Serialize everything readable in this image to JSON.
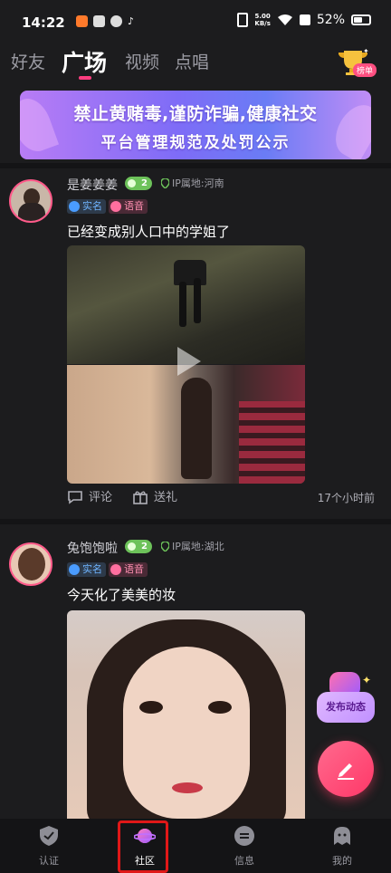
{
  "status_bar": {
    "time": "14:22",
    "net_speed_value": "5.00",
    "net_speed_unit": "KB/s",
    "battery": "52%"
  },
  "top_tabs": [
    {
      "label": "好友",
      "active": false
    },
    {
      "label": "广场",
      "active": true
    },
    {
      "label": "视频",
      "active": false
    },
    {
      "label": "点唱",
      "active": false
    }
  ],
  "rank": {
    "label": "榜单",
    "icon": "trophy-icon"
  },
  "banner": {
    "line1": "禁止黄赌毒,谨防诈骗,健康社交",
    "line2": "平台管理规范及处罚公示"
  },
  "posts": [
    {
      "username": "是姜姜姜",
      "level": "2",
      "ip": "IP属地:河南",
      "tags": [
        "实名",
        "语音"
      ],
      "text": "已经变成别人口中的学姐了",
      "actions": {
        "comment": "评论",
        "gift": "送礼"
      },
      "time": "17个小时前"
    },
    {
      "username": "兔饱饱啦",
      "level": "2",
      "ip": "IP属地:湖北",
      "tags": [
        "实名",
        "语音"
      ],
      "text": "今天化了美美的妆"
    }
  ],
  "float_publish": {
    "label": "发布动态"
  },
  "bottom_nav": [
    {
      "label": "认证",
      "icon": "shield-check-icon",
      "active": false
    },
    {
      "label": "社区",
      "icon": "planet-icon",
      "active": true
    },
    {
      "label": "信息",
      "icon": "message-icon",
      "active": false
    },
    {
      "label": "我的",
      "icon": "ghost-profile-icon",
      "active": false
    }
  ],
  "colors": {
    "accent": "#ff3d7f",
    "background": "#1c1c1e",
    "highlight_box": "#e01818"
  }
}
